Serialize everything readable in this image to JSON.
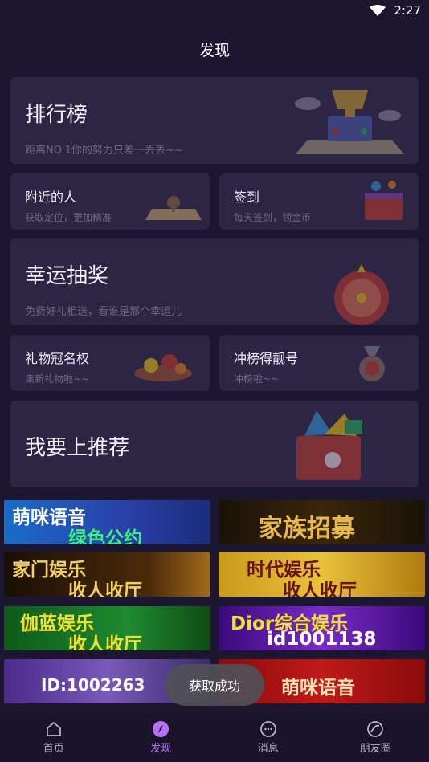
{
  "status": {
    "time": "2:27"
  },
  "header": {
    "title": "发现"
  },
  "cards": {
    "ranking": {
      "title": "排行榜",
      "subtitle": "距离NO.1你的努力只差一丢丢~~"
    },
    "nearby": {
      "title": "附近的人",
      "subtitle": "获取定位，更加精准"
    },
    "checkin": {
      "title": "签到",
      "subtitle": "每天签到，领金币"
    },
    "lottery": {
      "title": "幸运抽奖",
      "subtitle": "免费好礼相送，看谁是那个幸运儿"
    },
    "gift_title": {
      "title": "礼物冠名权",
      "subtitle": "集新礼物啦~~"
    },
    "rank_number": {
      "title": "冲榜得靓号",
      "subtitle": "冲榜啦~~"
    },
    "recommend": {
      "title": "我要上推荐"
    }
  },
  "banners": [
    {
      "line1": "萌咪语音",
      "line2": "绿色公约"
    },
    {
      "line1": "家族招募",
      "line2": ""
    },
    {
      "line1": "家门娱乐",
      "line2": "收人收厅"
    },
    {
      "line1": "时代娱乐",
      "line2": "收人收厅"
    },
    {
      "line1": "伽蓝娱乐",
      "line2": "收人收厅"
    },
    {
      "line1": "Dior综合娱乐",
      "line2": "id1001138"
    },
    {
      "line1": "",
      "line2": "ID:1002263"
    },
    {
      "line1": "萌咪语音",
      "line2": ""
    }
  ],
  "toast": "获取成功",
  "tabs": [
    {
      "label": "首页",
      "icon": "home-icon"
    },
    {
      "label": "发现",
      "icon": "compass-icon",
      "active": true
    },
    {
      "label": "消息",
      "icon": "message-icon"
    },
    {
      "label": "朋友圈",
      "icon": "moments-icon"
    }
  ],
  "colors": {
    "background": "#1d1630",
    "card": "#2d2544",
    "accent": "#b574f8"
  }
}
